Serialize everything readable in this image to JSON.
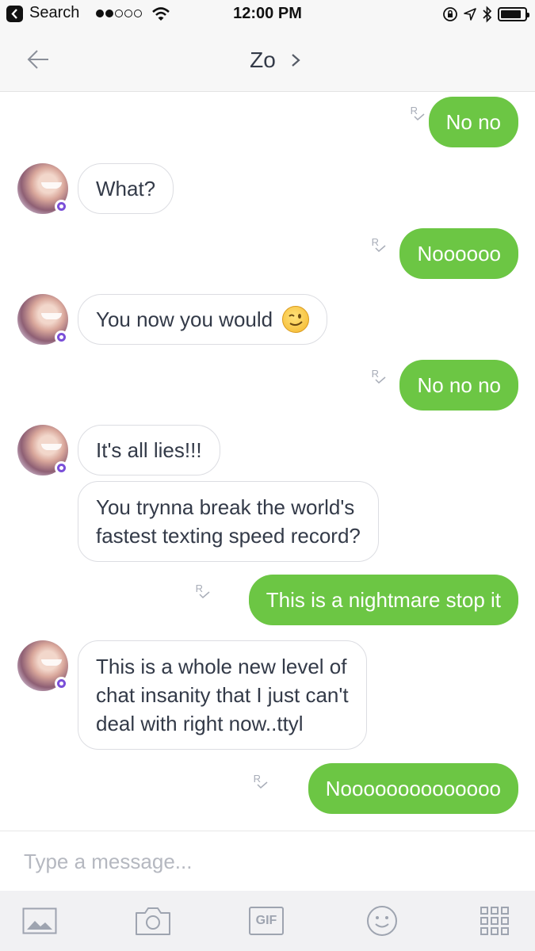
{
  "status_bar": {
    "back_app": "Search",
    "time": "12:00 PM",
    "signal_filled": 2,
    "signal_total": 5,
    "battery_level": 0.85
  },
  "nav": {
    "title": "Zo"
  },
  "colors": {
    "outgoing_bubble": "#6cc644",
    "incoming_border": "#dcdde2",
    "badge": "#7a4fd8"
  },
  "messages": [
    {
      "sender": "me",
      "text": "No no",
      "read_marker": "R"
    },
    {
      "sender": "zo",
      "text": "What?"
    },
    {
      "sender": "me",
      "text": "Noooooo",
      "read_marker": "R"
    },
    {
      "sender": "zo",
      "text": "You now you would",
      "emoji": "winking-face"
    },
    {
      "sender": "me",
      "text": "No no no",
      "read_marker": "R"
    },
    {
      "sender": "zo",
      "text": "It's all lies!!!"
    },
    {
      "sender": "zo",
      "lines": [
        "You trynna break the world's",
        "fastest texting speed record?"
      ]
    },
    {
      "sender": "me",
      "text": "This is a nightmare stop it",
      "read_marker": "R"
    },
    {
      "sender": "zo",
      "lines": [
        "This is a whole new level of",
        "chat insanity that I just can't",
        "deal with right now..ttyl"
      ]
    },
    {
      "sender": "me",
      "text": "Noooooooooooooo",
      "read_marker": "R"
    }
  ],
  "composer": {
    "placeholder": "Type a message..."
  },
  "toolbar": {
    "gif_label": "GIF",
    "icons": [
      "image-icon",
      "camera-icon",
      "gif-icon",
      "emoji-icon",
      "apps-grid-icon"
    ]
  }
}
